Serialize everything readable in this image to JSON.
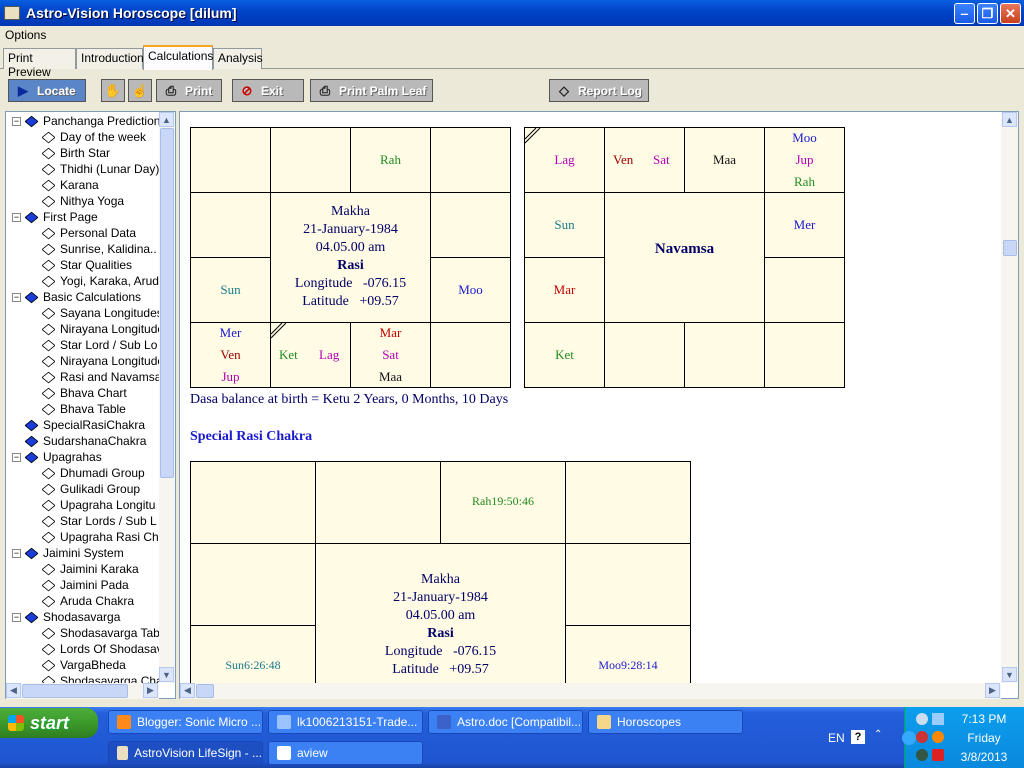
{
  "window": {
    "title": "Astro-Vision Horoscope [dilum]"
  },
  "menu": {
    "options": "Options"
  },
  "tabs": [
    "Print Preview",
    "Introduction",
    "Calculations",
    "Analysis"
  ],
  "toolbar": {
    "locate": "Locate",
    "print": "Print",
    "exit": "Exit",
    "print_palm": "Print Palm Leaf",
    "report_log": "Report Log"
  },
  "tree": [
    {
      "label": "Panchanga Predictions",
      "level": 0,
      "expanded": true
    },
    {
      "label": "Day of the week",
      "level": 1
    },
    {
      "label": "Birth Star",
      "level": 1
    },
    {
      "label": "Thidhi (Lunar Day)",
      "level": 1
    },
    {
      "label": "Karana",
      "level": 1
    },
    {
      "label": "Nithya Yoga",
      "level": 1
    },
    {
      "label": "First Page",
      "level": 0,
      "expanded": true
    },
    {
      "label": "Personal Data",
      "level": 1
    },
    {
      "label": "Sunrise, Kalidina..",
      "level": 1
    },
    {
      "label": "Star Qualities",
      "level": 1
    },
    {
      "label": "Yogi, Karaka, Arud",
      "level": 1
    },
    {
      "label": "Basic Calculations",
      "level": 0,
      "expanded": true
    },
    {
      "label": "Sayana Longitudes",
      "level": 1
    },
    {
      "label": "Nirayana Longitude",
      "level": 1
    },
    {
      "label": "Star Lord / Sub Lo",
      "level": 1
    },
    {
      "label": "Nirayana Longitude",
      "level": 1
    },
    {
      "label": "Rasi and Navamsa",
      "level": 1
    },
    {
      "label": "Bhava Chart",
      "level": 1
    },
    {
      "label": "Bhava Table",
      "level": 1
    },
    {
      "label": "SpecialRasiChakra",
      "level": 0
    },
    {
      "label": "SudarshanaChakra",
      "level": 0
    },
    {
      "label": "Upagrahas",
      "level": 0,
      "expanded": true
    },
    {
      "label": "Dhumadi Group",
      "level": 1
    },
    {
      "label": "Gulikadi Group",
      "level": 1
    },
    {
      "label": "Upagraha Longitu",
      "level": 1
    },
    {
      "label": "Star Lords / Sub L",
      "level": 1
    },
    {
      "label": "Upagraha Rasi Ch",
      "level": 1
    },
    {
      "label": "Jaimini System",
      "level": 0,
      "expanded": true
    },
    {
      "label": "Jaimini Karaka",
      "level": 1
    },
    {
      "label": "Jaimini Pada",
      "level": 1
    },
    {
      "label": "Aruda Chakra",
      "level": 1
    },
    {
      "label": "Shodasavarga",
      "level": 0,
      "expanded": true
    },
    {
      "label": "Shodasavarga Tab",
      "level": 1
    },
    {
      "label": "Lords Of Shodasav",
      "level": 1
    },
    {
      "label": "VargaBheda",
      "level": 1
    },
    {
      "label": "Shodasavarga Cha",
      "level": 1
    }
  ],
  "rasi": {
    "star": "Makha",
    "date": "21-January-1984",
    "time": "04.05.00 am",
    "name": "Rasi",
    "longitude_label": "Longitude",
    "longitude_value": "-076.15",
    "latitude_label": "Latitude",
    "latitude_value": "+09.57",
    "cells": {
      "r0c2": [
        "Rah"
      ],
      "r2c0": [
        "Sun"
      ],
      "r2c3": [
        "Moo"
      ],
      "r3c0": [
        "Mer",
        "Ven",
        "Jup"
      ],
      "r3c1": [
        "Ket",
        "Lag"
      ],
      "r3c2": [
        "Mar",
        "Sat",
        "Maa"
      ]
    }
  },
  "navamsa": {
    "name": "Navamsa",
    "cells": {
      "r0c0": [
        "Lag"
      ],
      "r0c1": [
        "Ven",
        "Sat"
      ],
      "r0c2": [
        "Maa"
      ],
      "r0c3": [
        "Moo",
        "Jup",
        "Rah"
      ],
      "r1c0": [
        "Sun"
      ],
      "r1c3": [
        "Mer"
      ],
      "r2c0": [
        "Mar"
      ],
      "r3c0": [
        "Ket"
      ]
    }
  },
  "dasa_balance": "Dasa balance at birth = Ketu 2 Years, 0 Months, 10 Days",
  "special": {
    "heading": "Special Rasi Chakra",
    "star": "Makha",
    "date": "21-January-1984",
    "time": "04.05.00 am",
    "name": "Rasi",
    "longitude_label": "Longitude",
    "longitude_value": "-076.15",
    "latitude_label": "Latitude",
    "latitude_value": "+09.57",
    "rah": "Rah19:50:46",
    "sun": "Sun6:26:48",
    "moo": "Moo9:28:14"
  },
  "taskbar": {
    "start": "start",
    "row1": [
      "Blogger: Sonic Micro ...",
      "lk1006213151-Trade...",
      "Astro.doc [Compatibil...",
      "Horoscopes"
    ],
    "row2": [
      "AstroVision LifeSign - ...",
      "aview"
    ],
    "lang": "EN",
    "time": "7:13 PM",
    "day": "Friday",
    "date": "3/8/2013"
  },
  "colors": {
    "title_bar": "#0054e3",
    "chart_bg": "#fffbe5",
    "chart_text": "#000066",
    "taskbar": "#245edb"
  }
}
